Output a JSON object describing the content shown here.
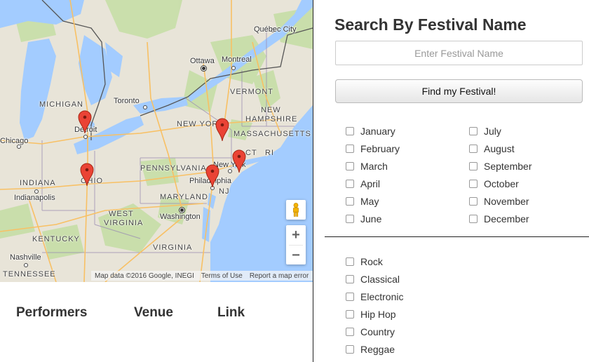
{
  "map": {
    "regions": {
      "michigan": "MICHIGAN",
      "vermont": "VERMONT",
      "new_hampshire_line1": "NEW",
      "new_hampshire_line2": "HAMPSHIRE",
      "new_york": "NEW YORK",
      "massachusetts": "MASSACHUSETTS",
      "ct": "CT",
      "ri": "RI",
      "pennsylvania": "PENNSYLVANIA",
      "indiana": "INDIANA",
      "ohio": "OHIO",
      "maryland": "MARYLAND",
      "west_virginia_line1": "WEST",
      "west_virginia_line2": "VIRGINIA",
      "nj": "NJ",
      "kentucky": "KENTUCKY",
      "virginia": "VIRGINIA",
      "tennessee": "TENNESSEE"
    },
    "cities": {
      "quebec_city": "Québec City",
      "ottawa": "Ottawa",
      "montreal": "Montreal",
      "toronto": "Toronto",
      "detroit": "Detroit",
      "chicago": "Chicago",
      "new_york": "New York",
      "philadelphia": "Philadelphia",
      "indianapolis": "Indianapolis",
      "washington": "Washington",
      "nashville": "Nashville"
    },
    "markers": [
      "Detroit",
      "Ohio",
      "New York State",
      "Philadelphia",
      "New York"
    ],
    "attribution": {
      "data": "Map data ©2016 Google, INEGI",
      "terms": "Terms of Use",
      "report": "Report a map error"
    },
    "zoom_in": "+",
    "zoom_out": "−"
  },
  "table": {
    "headers": [
      "Performers",
      "Venue",
      "Link"
    ]
  },
  "panel": {
    "title": "Search By Festival Name",
    "search_placeholder": "Enter Festival Name",
    "search_value": "",
    "find_button": "Find my Festival!",
    "months_left": [
      "January",
      "February",
      "March",
      "April",
      "May",
      "June"
    ],
    "months_right": [
      "July",
      "August",
      "September",
      "October",
      "November",
      "December"
    ],
    "genres": [
      "Rock",
      "Classical",
      "Electronic",
      "Hip Hop",
      "Country",
      "Reggae"
    ]
  },
  "colors": {
    "water": "#a3ccff",
    "land": "#e8e4d8",
    "forest": "#c4dea4",
    "highway": "#f8c064",
    "marker": "#ea4335"
  }
}
